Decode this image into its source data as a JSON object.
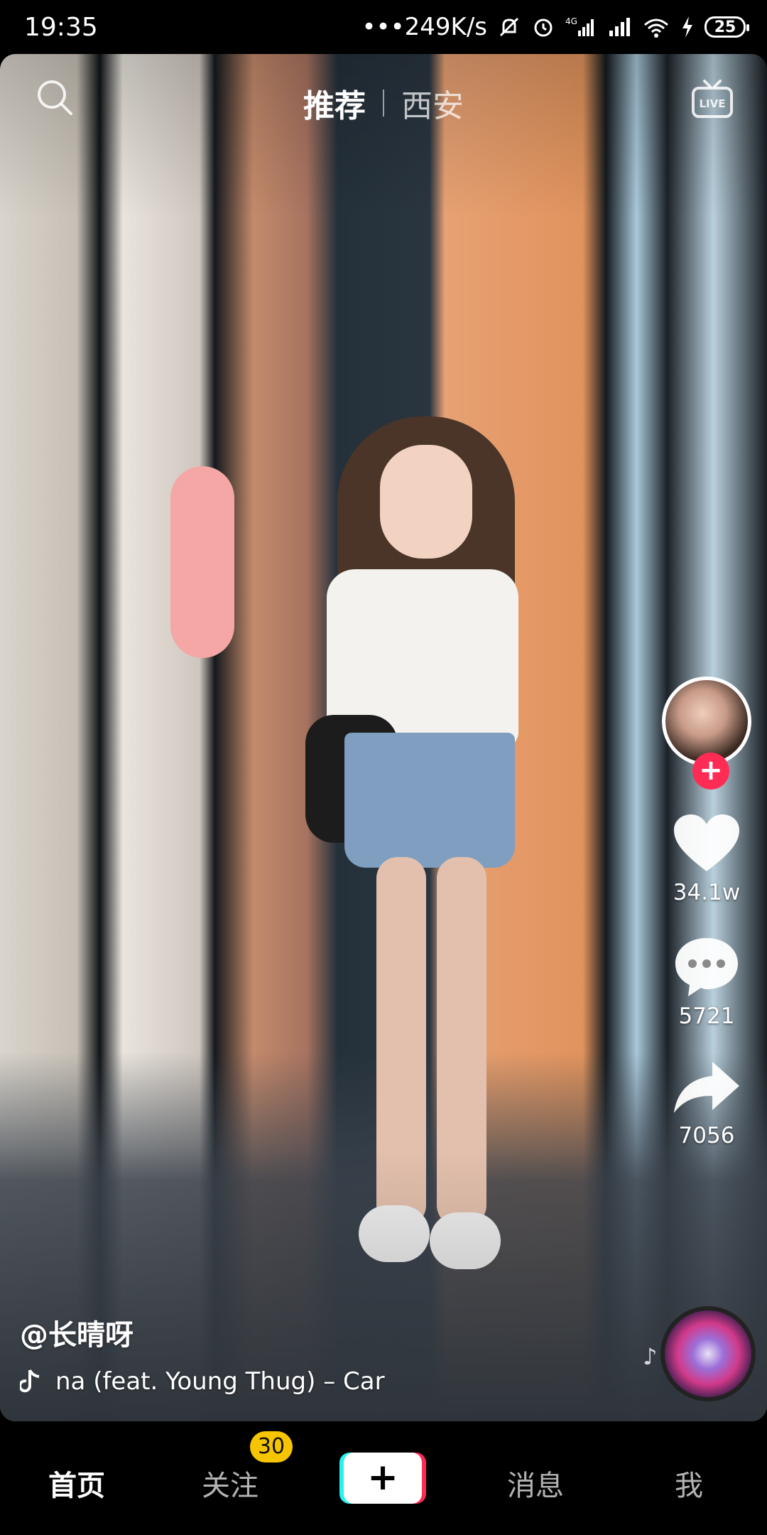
{
  "status_bar": {
    "time": "19:35",
    "network_speed": "•••249K/s",
    "battery": "25",
    "icons": [
      "mute-icon",
      "alarm-icon",
      "4g-signal-icon",
      "signal-icon",
      "wifi-icon",
      "charging-icon",
      "battery-icon"
    ]
  },
  "top_tabs": [
    {
      "label": "推荐",
      "active": true
    },
    {
      "label": "西安",
      "active": false
    }
  ],
  "header_icons": {
    "left": "search-icon",
    "right": "live-icon"
  },
  "sidebar": {
    "avatar": "creator-avatar",
    "follow_symbol": "+",
    "like_count": "34.1w",
    "comment_count": "5721",
    "share_count": "7056"
  },
  "video_info": {
    "author": "@长晴呀",
    "music": "na (feat. Young Thug) – Car"
  },
  "bottom_nav": {
    "home": "首页",
    "follow": "关注",
    "follow_badge": "30",
    "create": "+",
    "messages": "消息",
    "me": "我"
  },
  "colors": {
    "accent_red": "#fe2c55",
    "accent_cyan": "#25f4ee",
    "badge_yellow": "#f7c400"
  }
}
